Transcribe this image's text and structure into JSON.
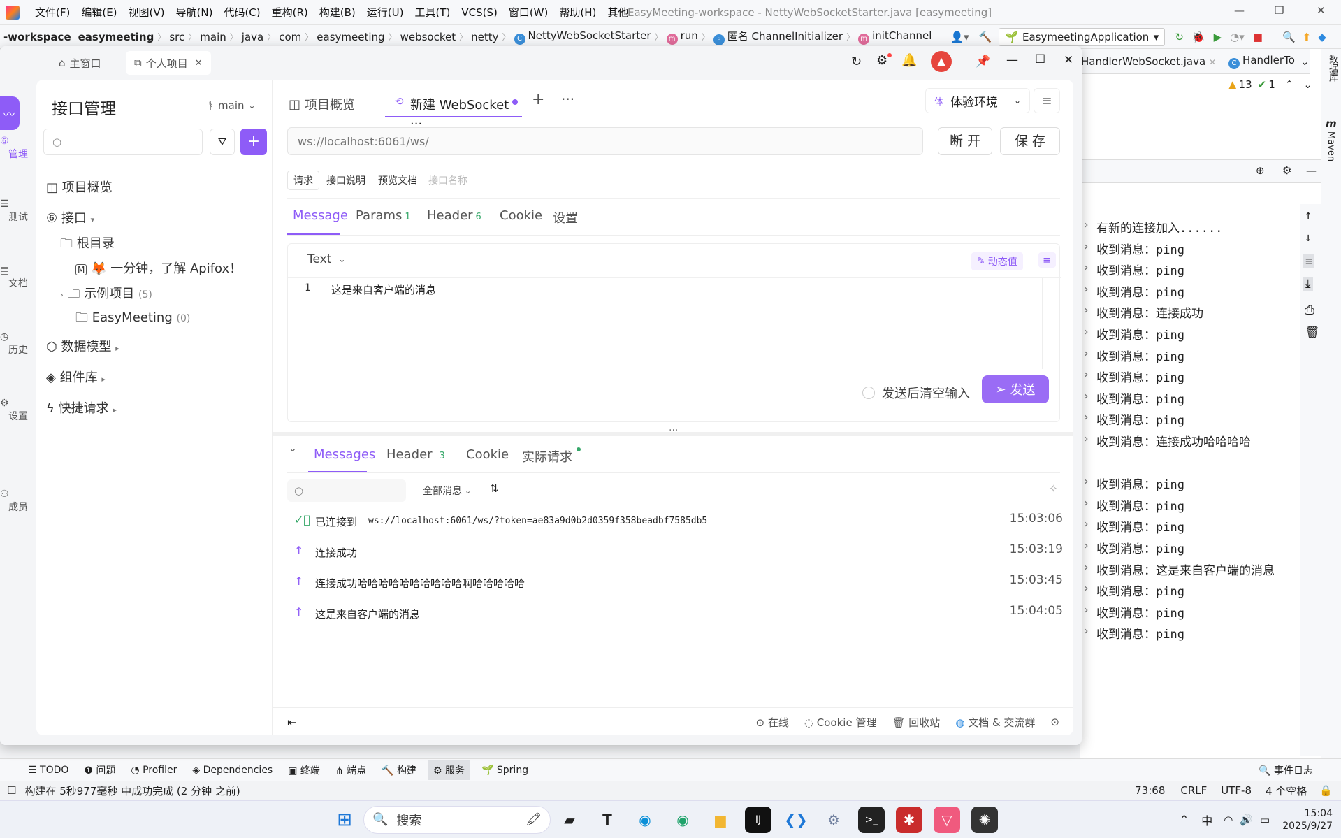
{
  "ide": {
    "menus": [
      "文件(F)",
      "编辑(E)",
      "视图(V)",
      "导航(N)",
      "代码(C)",
      "重构(R)",
      "构建(B)",
      "运行(U)",
      "工具(T)",
      "VCS(S)",
      "窗口(W)",
      "帮助(H)",
      "其他"
    ],
    "title": "EasyMeeting-workspace - NettyWebSocketStarter.java [easymeeting]",
    "breadcrumbs": [
      "-workspace",
      "easymeeting",
      "src",
      "main",
      "java",
      "com",
      "easymeeting",
      "websocket",
      "netty",
      "NettyWebSocketStarter",
      "run",
      "匿名 ChannelInitializer",
      "initChannel"
    ],
    "run_config": "EasymeetingApplication",
    "editor_tabs": [
      "HandlerWebSocket.java",
      "HandlerTo"
    ],
    "warnings": "13",
    "oks": "1",
    "side_labels": [
      "数据库",
      "Maven"
    ],
    "console_lines": [
      "有新的连接加入......",
      "收到消息：ping",
      "收到消息：ping",
      "收到消息：ping",
      "收到消息：连接成功",
      "收到消息：ping",
      "收到消息：ping",
      "收到消息：ping",
      "收到消息：ping",
      "收到消息：ping",
      "收到消息：连接成功哈哈哈哈",
      "",
      "收到消息：ping",
      "收到消息：ping",
      "收到消息：ping",
      "收到消息：ping",
      "收到消息：这是来自客户端的消息",
      "收到消息：ping",
      "收到消息：ping",
      "收到消息：ping"
    ],
    "tool_windows": [
      "TODO",
      "问题",
      "Profiler",
      "Dependencies",
      "终端",
      "端点",
      "构建",
      "服务",
      "Spring"
    ],
    "event_log": "事件日志",
    "status_msg": "构建在 5秒977毫秒 中成功完成 (2 分钟 之前)",
    "cursor_pos": "73:68",
    "line_sep": "CRLF",
    "encoding": "UTF-8",
    "indent": "4 个空格"
  },
  "apifox": {
    "window_tabs": [
      "主窗口",
      "个人项目"
    ],
    "rail": [
      "管理",
      "测试",
      "文档",
      "历史",
      "设置",
      "成员"
    ],
    "sidebar": {
      "title": "接口管理",
      "branch": "main",
      "items": [
        {
          "label": "项目概览"
        },
        {
          "label": "接口"
        },
        {
          "label": "根目录"
        },
        {
          "label": "🦊 一分钟，了解 Apifox！"
        },
        {
          "label": "示例项目",
          "count": "(5)"
        },
        {
          "label": "EasyMeeting",
          "count": "(0)"
        },
        {
          "label": "数据模型"
        },
        {
          "label": "组件库"
        },
        {
          "label": "快捷请求"
        }
      ]
    },
    "tabs": [
      "项目概览",
      "新建 WebSocket ..."
    ],
    "env": {
      "badge": "体",
      "label": "体验环境"
    },
    "url_placeholder": "ws://localhost:6061/ws/",
    "disconnect": "断 开",
    "save": "保 存",
    "subtabs": [
      "请求",
      "接口说明",
      "预览文档"
    ],
    "name_placeholder": "接口名称",
    "req_tabs": [
      {
        "label": "Message"
      },
      {
        "label": "Params",
        "count": "1"
      },
      {
        "label": "Header",
        "count": "6"
      },
      {
        "label": "Cookie"
      },
      {
        "label": "设置"
      }
    ],
    "format": "Text",
    "dynamic": "动态值",
    "editor_line_no": "1",
    "editor_text": "这是来自客户端的消息",
    "clear_after_send": "发送后清空输入",
    "send": "发送",
    "resp_tabs": [
      {
        "label": "Messages"
      },
      {
        "label": "Header",
        "count": "3"
      },
      {
        "label": "Cookie"
      },
      {
        "label": "实际请求"
      }
    ],
    "filter": "全部消息",
    "messages": [
      {
        "text": "已连接到",
        "url": "ws://localhost:6061/ws/?token=ae83a9d0b2d0359f358beadbf7585db5",
        "time": "15:03:06",
        "kind": "connected"
      },
      {
        "text": "连接成功",
        "time": "15:03:19",
        "kind": "sent"
      },
      {
        "text": "连接成功哈哈哈哈哈哈哈哈哈哈啊哈哈哈哈哈",
        "time": "15:03:45",
        "kind": "sent"
      },
      {
        "text": "这是来自客户端的消息",
        "time": "15:04:05",
        "kind": "sent"
      }
    ],
    "footer": [
      "在线",
      "Cookie 管理",
      "回收站",
      "文档 & 交流群"
    ]
  },
  "taskbar": {
    "search": "搜索",
    "ime": "中",
    "time": "15:04",
    "date": "2025/9/27"
  },
  "colors": {
    "accent": "#8e5cf7",
    "ok": "#37a86a"
  }
}
